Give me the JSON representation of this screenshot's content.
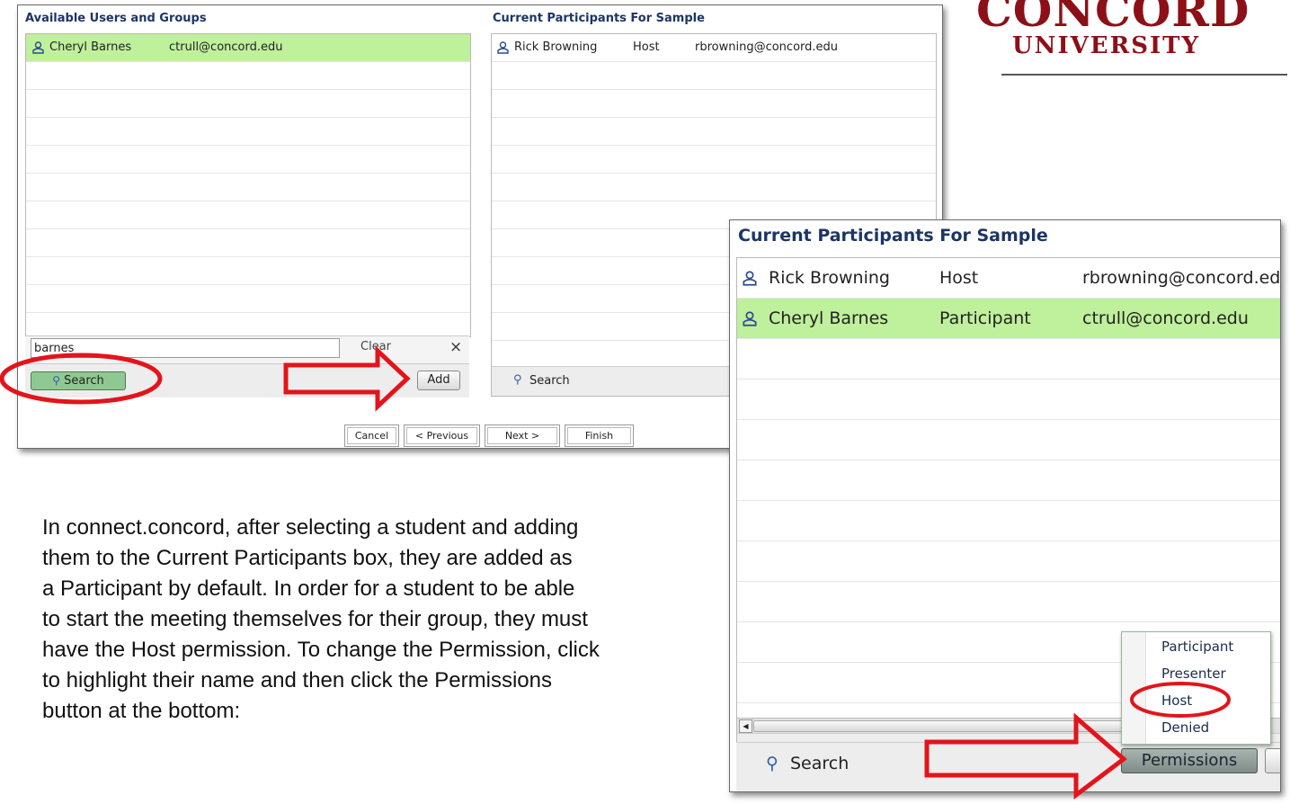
{
  "logo": {
    "line1": "CONCORD",
    "line2": "UNIVERSITY"
  },
  "dialog": {
    "available_title": "Available Users and Groups",
    "participants_title": "Current Participants For Sample",
    "available_rows": [
      {
        "name": "Cheryl Barnes",
        "email": "ctrull@concord.edu"
      }
    ],
    "participant_rows": [
      {
        "name": "Rick Browning",
        "role": "Host",
        "email": "rbrowning@concord.edu"
      }
    ],
    "search_input_value": "barnes",
    "clear_label": "Clear",
    "clear_x": "×",
    "search_label": "Search",
    "add_label": "Add",
    "participants_search_label": "Search",
    "wizard": {
      "cancel": "Cancel",
      "previous": "< Previous",
      "next": "Next >",
      "finish": "Finish"
    }
  },
  "zoomed": {
    "title": "Current Participants For Sample",
    "rows": [
      {
        "name": "Rick Browning",
        "role": "Host",
        "email": "rbrowning@concord.ed"
      },
      {
        "name": "Cheryl Barnes",
        "role": "Participant",
        "email": "ctrull@concord.edu"
      }
    ],
    "search_label": "Search",
    "permissions_label": "Permissions",
    "menu_items": [
      "Participant",
      "Presenter",
      "Host",
      "Denied"
    ]
  },
  "instructions": [
    "In connect.concord, after selecting a student and adding",
    "them to the Current Participants box, they are added as",
    "a Participant by default. In order for a student to be able",
    "to start the meeting themselves for their group, they must",
    "have the Host permission. To change the Permission, click",
    "to highlight their name and then click the Permissions",
    "button at the bottom:"
  ],
  "colors": {
    "selected_row": "#bff09b",
    "highlight_red": "#e3141b",
    "brand_maroon": "#8c1018",
    "title_navy": "#1c3566"
  }
}
